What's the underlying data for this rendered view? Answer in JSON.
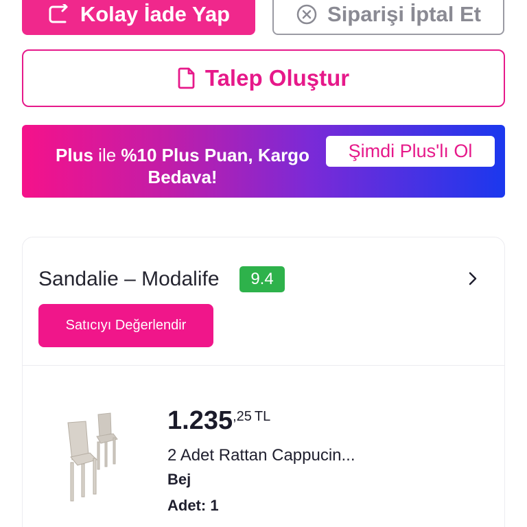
{
  "actions": {
    "easy_return_label": "Kolay İade Yap",
    "cancel_order_label": "Siparişi İptal Et",
    "create_request_label": "Talep Oluştur"
  },
  "plus_banner": {
    "text_bold_1": "Plus",
    "text_regular_1": " ile ",
    "text_bold_2": "%10 Plus Puan, Kargo Bedava!",
    "cta_label": "Şimdi Plus'lı Ol"
  },
  "seller": {
    "name": "Sandalie – Modalife",
    "score": "9.4",
    "rate_button_label": "Satıcıyı Değerlendir"
  },
  "product": {
    "price_main": "1.235",
    "price_cents": ",25",
    "price_currency": "TL",
    "title": "2 Adet Rattan Cappucin...",
    "color": "Bej",
    "quantity": "Adet: 1"
  },
  "colors": {
    "brand_pink": "#f0288c",
    "score_green": "#2eb24b",
    "gradient_blue": "#1b38ee"
  }
}
